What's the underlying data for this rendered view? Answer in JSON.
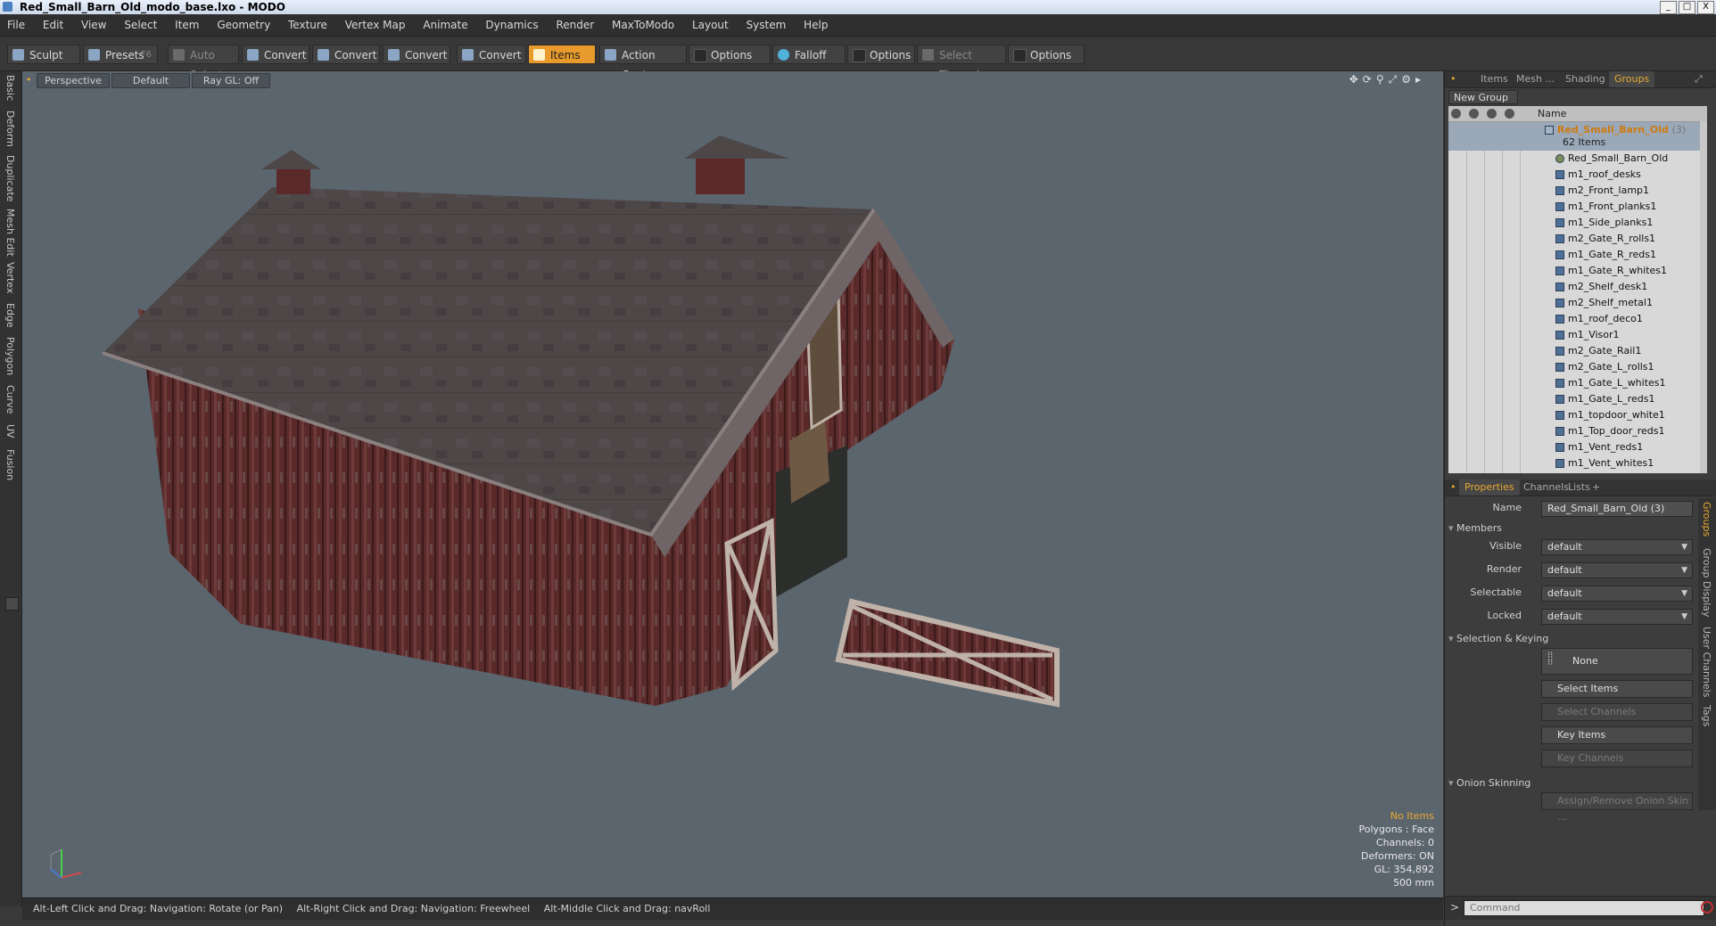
{
  "window": {
    "title": "Red_Small_Barn_Old_modo_base.lxo - MODO",
    "buttons": [
      "_",
      "□",
      "X"
    ]
  },
  "menu": [
    "File",
    "Edit",
    "View",
    "Select",
    "Item",
    "Geometry",
    "Texture",
    "Vertex Map",
    "Animate",
    "Dynamics",
    "Render",
    "MaxToModo",
    "Layout",
    "System",
    "Help"
  ],
  "toolbar": {
    "sculpt": "Sculpt",
    "presets": "Presets",
    "presets_key": "F6",
    "auto_select": "Auto Select",
    "convert1": "Convert",
    "convert2": "Convert",
    "convert3": "Convert",
    "convert4": "Convert",
    "items": "Items",
    "action_center": "Action Center",
    "options1": "Options",
    "falloff": "Falloff",
    "options2": "Options",
    "select_through": "Select Through",
    "options3": "Options"
  },
  "left_tabs": [
    "Basic",
    "Deform",
    "Duplicate",
    "Mesh Edit",
    "Vertex",
    "Edge",
    "Polygon",
    "Curve",
    "UV",
    "Fusion"
  ],
  "viewport": {
    "view": "Perspective",
    "shading": "Default",
    "raygl": "Ray GL: Off",
    "stats": {
      "no_items": "No Items",
      "polygons": "Polygons : Face",
      "channels": "Channels: 0",
      "deformers": "Deformers: ON",
      "gl": "GL: 354,892",
      "scale": "500 mm"
    }
  },
  "statusbar": {
    "hint1": "Alt-Left Click and Drag: Navigation: Rotate (or Pan)",
    "hint2": "Alt-Right Click and Drag: Navigation: Freewheel",
    "hint3": "Alt-Middle Click and Drag: navRoll"
  },
  "right_panel": {
    "tabs": [
      "Items",
      "Mesh ...",
      "Shading",
      "Groups"
    ],
    "new_group": "New Group",
    "col_name": "Name",
    "group": {
      "name": "Red_Small_Barn_Old",
      "count": "(3)",
      "sub": "62 Items"
    },
    "items": [
      "Red_Small_Barn_Old",
      "m1_roof_desks",
      "m2_Front_lamp1",
      "m1_Front_planks1",
      "m1_Side_planks1",
      "m2_Gate_R_rolls1",
      "m1_Gate_R_reds1",
      "m1_Gate_R_whites1",
      "m2_Shelf_desk1",
      "m2_Shelf_metal1",
      "m1_roof_deco1",
      "m1_Visor1",
      "m2_Gate_Rail1",
      "m2_Gate_L_rolls1",
      "m1_Gate_L_whites1",
      "m1_Gate_L_reds1",
      "m1_topdoor_white1",
      "m1_Top_door_reds1",
      "m1_Vent_reds1",
      "m1_Vent_whites1"
    ],
    "prop_tabs": [
      "Properties",
      "Channels",
      "Lists",
      "+"
    ],
    "props": {
      "name_label": "Name",
      "name_value": "Red_Small_Barn_Old (3)",
      "members": "Members",
      "visible_label": "Visible",
      "visible_value": "default",
      "render_label": "Render",
      "render_value": "default",
      "selectable_label": "Selectable",
      "selectable_value": "default",
      "locked_label": "Locked",
      "locked_value": "default",
      "selection_keying": "Selection & Keying",
      "none": "None",
      "select_items": "Select Items",
      "select_channels": "Select Channels",
      "key_items": "Key Items",
      "key_channels": "Key Channels",
      "onion": "Onion Skinning",
      "assign_onion": "Assign/Remove Onion Skin ..."
    },
    "vtabs": [
      "Groups",
      "Group Display",
      "User Channels",
      "Tags"
    ],
    "command_placeholder": "Command"
  }
}
